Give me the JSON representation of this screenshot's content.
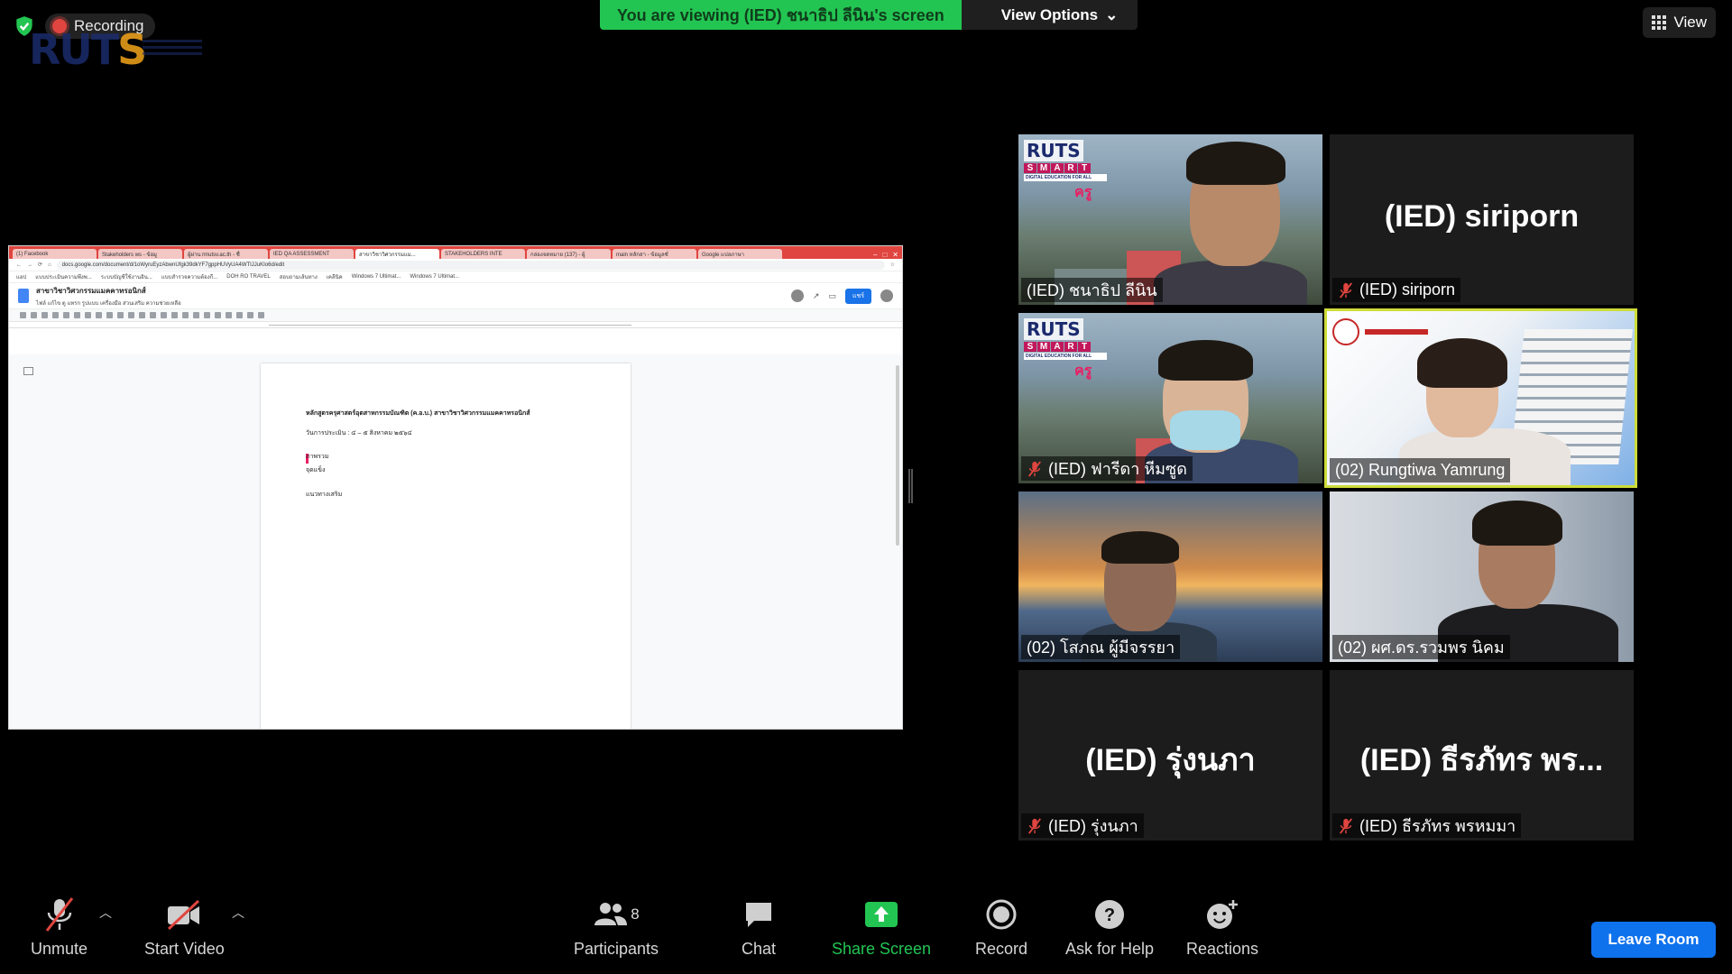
{
  "recording": {
    "label": "Recording"
  },
  "banner": {
    "viewing": "You are viewing (IED) ชนาธิป ลีนิน's screen",
    "view_options": "View Options"
  },
  "view_top": {
    "label": "View"
  },
  "browser": {
    "tabs": [
      "(1) Facebook",
      "Stakeholders ws - ข้อมู",
      "ผู้ผ่าน rmutsv.ac.th - ชื่",
      "IED QA ASSESSMENT",
      "สาขาวิชาวิศวกรรมแม...",
      "STAKEHOLDERS INTE",
      "กล่องจดหมาย (137) - ผู้",
      "main หลักสา - ข้อมูลชั่",
      "Google แปลภาษา"
    ],
    "url": "docs.google.com/document/d/1oWyruEyzAbwnUfgk39dkYF7gppHUVyUA4WTIJJuKIo6d/edit",
    "bookmarks": [
      "แอป",
      "แบบประเมินความพึงพ...",
      "ระบบบัญชีใช้งานอิน...",
      "แบบสำรวจความต้องกี...",
      "DOH RO TRAVEL",
      "สอบถามเส้นทาง",
      "เคลีนิค",
      "Windows 7 Ultimat...",
      "Windows 7 Ultimat..."
    ]
  },
  "doc": {
    "title": "สาขาวิชาวิศวกรรมแมคคาทรอนิกส์",
    "menu": "ไฟล์  แก้ไข  ดู  แทรก  รูปแบบ  เครื่องมือ  ส่วนเสริม  ความช่วยเหลือ",
    "share_label": "แชร์",
    "lines": {
      "line1": "หลักสูตรครุศาสตร์อุตสาหกรรมบัณฑิต (ค.อ.บ.) สาขาวิชาวิศวกรรมแมคคาทรอนิกส์",
      "line2": "วันการประเมิน : ๔ – ๕ สิงหาคม ๒๕๖๔",
      "line3": "ภาพรวม",
      "line4": "จุดแข็ง",
      "line5": "แนวทางเสริม"
    }
  },
  "participants": [
    {
      "name": "(IED) ชนาธิป ลีนิน",
      "muted": false,
      "video": true
    },
    {
      "name": "(IED) siriporn",
      "display_name": "(IED) siriporn",
      "muted": true,
      "video": false
    },
    {
      "name": "(IED) ฟารีดา หีมซูด",
      "muted": true,
      "video": true
    },
    {
      "name": "(02) Rungtiwa Yamrung",
      "muted": false,
      "video": true,
      "active_speaker": true
    },
    {
      "name": "(02) โสภณ ผู้มีจรรยา",
      "muted": false,
      "video": true
    },
    {
      "name": "(02) ผศ.ดร.รวมพร นิคม",
      "muted": false,
      "video": true
    },
    {
      "name": "(IED) รุ่งนภา",
      "display_name": "(IED)  รุ่งนภา",
      "muted": true,
      "video": false
    },
    {
      "name": "(IED) ธีรภัทร พรหมมา",
      "display_name": "(IED)  ธีรภัทร พร...",
      "muted": true,
      "video": false
    }
  ],
  "controls": {
    "unmute": "Unmute",
    "start_video": "Start Video",
    "participants": "Participants",
    "participants_count": "8",
    "chat": "Chat",
    "share_screen": "Share Screen",
    "record": "Record",
    "ask_help": "Ask for Help",
    "reactions": "Reactions",
    "leave": "Leave Room"
  },
  "colors": {
    "green": "#23c552",
    "leave_blue": "#0e72ed",
    "active_border": "#cddc39",
    "mute_red": "#e0453f"
  }
}
